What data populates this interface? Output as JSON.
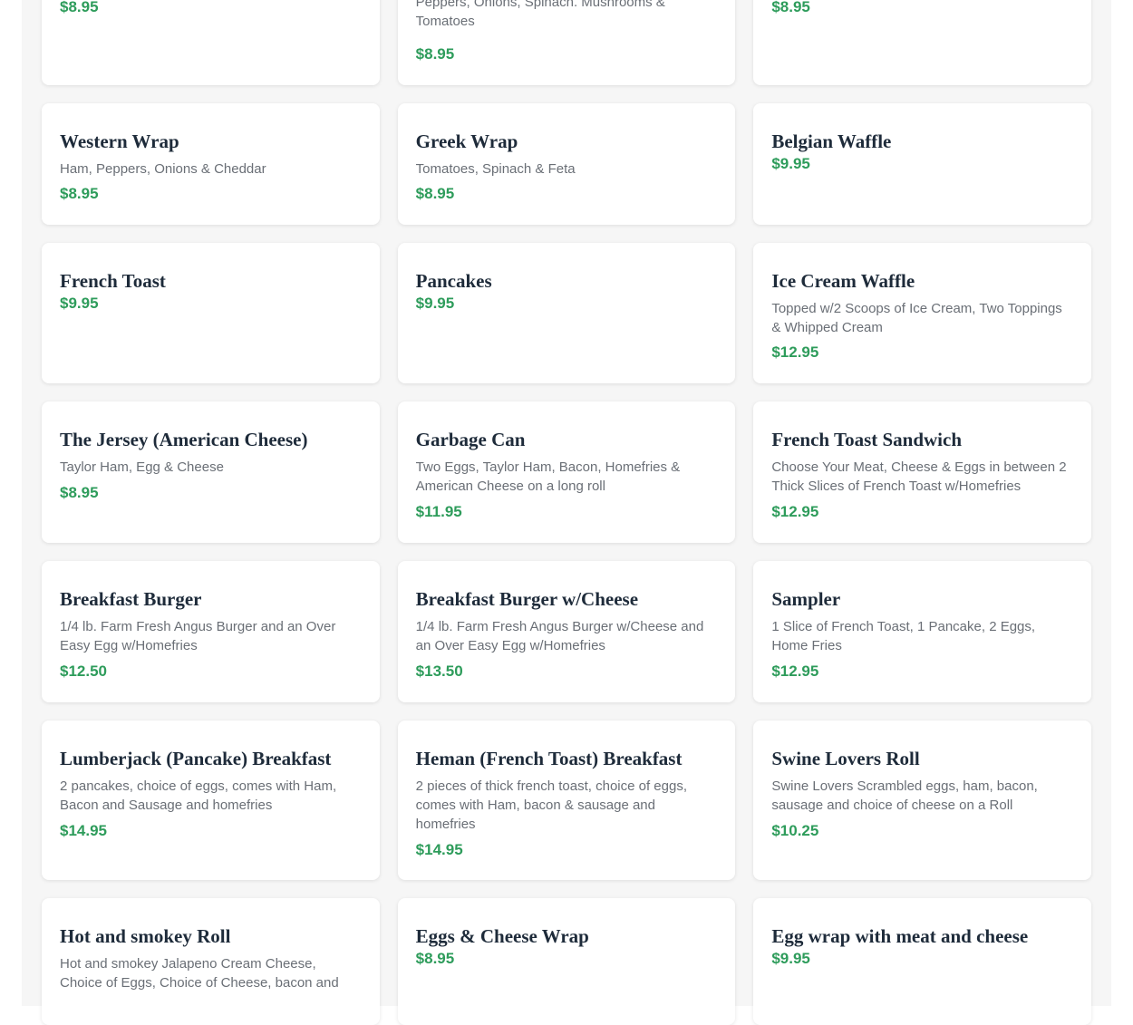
{
  "menu_items": [
    {
      "name": "",
      "desc": "",
      "price": "$8.95"
    },
    {
      "name": "",
      "desc": "Peppers, Onions, Spinach. Mushrooms & Tomatoes",
      "price": "$8.95"
    },
    {
      "name": "",
      "desc": "",
      "price": "$8.95"
    },
    {
      "name": "Western Wrap",
      "desc": "Ham, Peppers, Onions & Cheddar",
      "price": "$8.95"
    },
    {
      "name": "Greek Wrap",
      "desc": "Tomatoes, Spinach & Feta",
      "price": "$8.95"
    },
    {
      "name": "Belgian Waffle",
      "desc": "",
      "price": "$9.95"
    },
    {
      "name": "French Toast",
      "desc": "",
      "price": "$9.95"
    },
    {
      "name": "Pancakes",
      "desc": "",
      "price": "$9.95"
    },
    {
      "name": "Ice Cream Waffle",
      "desc": "Topped w/2 Scoops of Ice Cream, Two Toppings & Whipped Cream",
      "price": "$12.95"
    },
    {
      "name": "The Jersey (American Cheese)",
      "desc": "Taylor Ham, Egg & Cheese",
      "price": "$8.95"
    },
    {
      "name": "Garbage Can",
      "desc": "Two Eggs, Taylor Ham, Bacon, Homefries & American Cheese on a long roll",
      "price": "$11.95"
    },
    {
      "name": "French Toast Sandwich",
      "desc": "Choose Your Meat, Cheese & Eggs in between 2 Thick Slices of French Toast w/Homefries",
      "price": "$12.95"
    },
    {
      "name": "Breakfast Burger",
      "desc": "1/4 lb. Farm Fresh Angus Burger and an Over Easy Egg w/Homefries",
      "price": "$12.50"
    },
    {
      "name": "Breakfast Burger w/Cheese",
      "desc": "1/4 lb. Farm Fresh Angus Burger w/Cheese and an Over Easy Egg w/Homefries",
      "price": "$13.50"
    },
    {
      "name": "Sampler",
      "desc": "1 Slice of French Toast, 1 Pancake, 2 Eggs, Home Fries",
      "price": "$12.95"
    },
    {
      "name": "Lumberjack (Pancake) Breakfast",
      "desc": "2 pancakes, choice of eggs, comes with Ham, Bacon and Sausage and homefries",
      "price": "$14.95"
    },
    {
      "name": "Heman (French Toast) Breakfast",
      "desc": "2 pieces of thick french toast, choice of eggs, comes with Ham, bacon & sausage and homefries",
      "price": "$14.95"
    },
    {
      "name": "Swine Lovers Roll",
      "desc": "Swine Lovers Scrambled eggs, ham, bacon, sausage and choice of cheese on a Roll",
      "price": "$10.25"
    },
    {
      "name": "Hot and smokey Roll",
      "desc": "Hot and smokey Jalapeno Cream Cheese, Choice of Eggs, Choice of Cheese, bacon and",
      "price": ""
    },
    {
      "name": "Eggs & Cheese Wrap",
      "desc": "",
      "price": "$8.95"
    },
    {
      "name": "Egg wrap with meat and cheese",
      "desc": "",
      "price": "$9.95"
    }
  ]
}
